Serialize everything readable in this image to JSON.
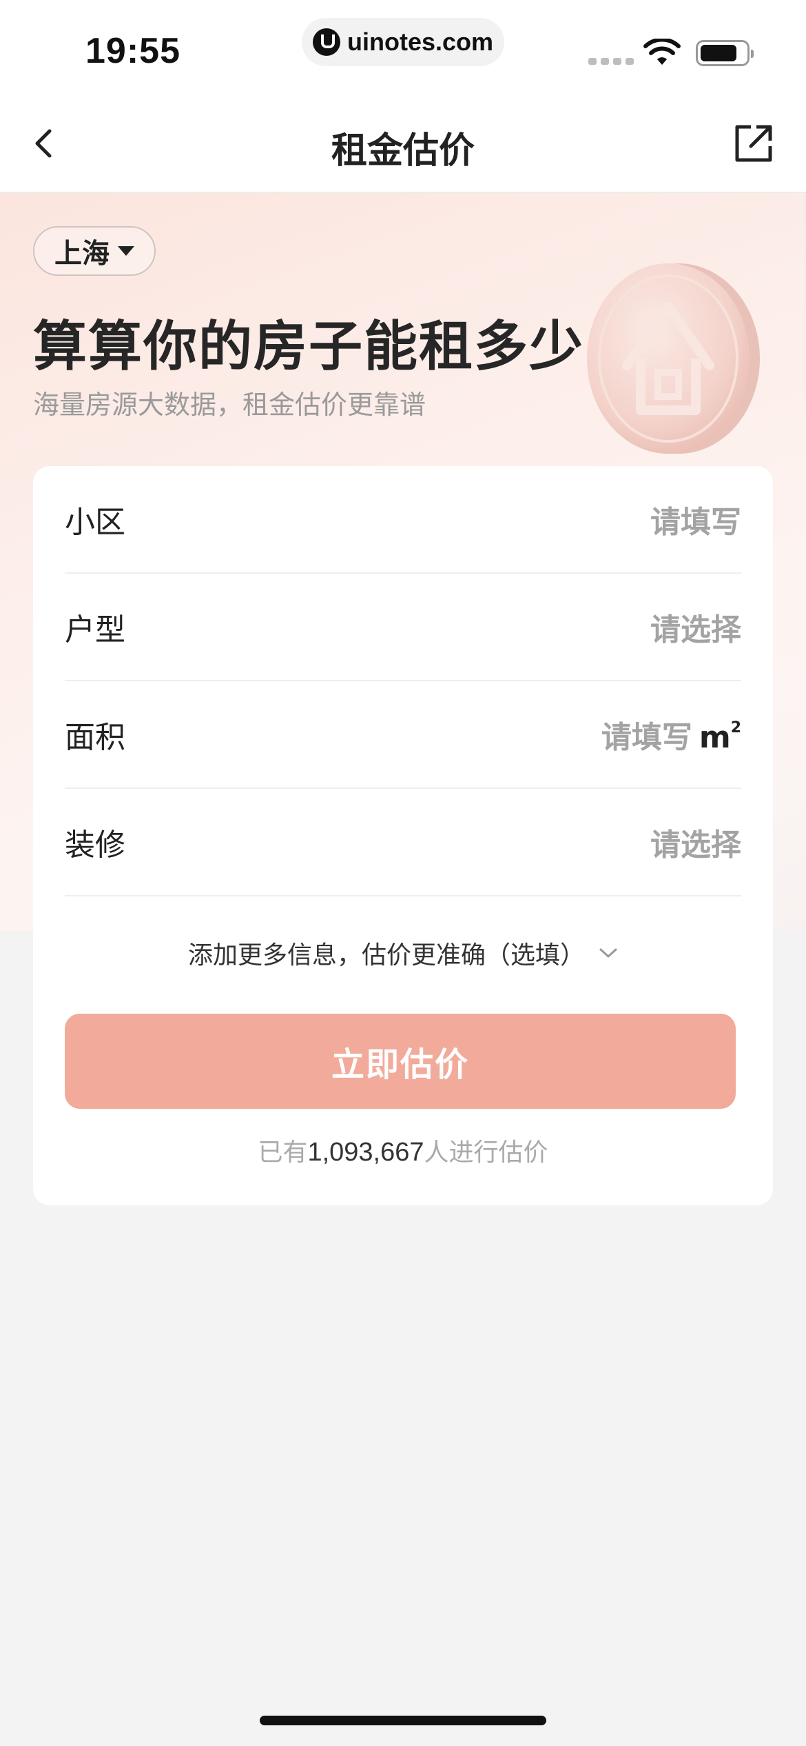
{
  "status_bar": {
    "time": "19:55",
    "url": "uinotes.com"
  },
  "nav": {
    "title": "租金估价",
    "back_icon": "chevron-left-icon",
    "share_icon": "external-link-icon"
  },
  "hero": {
    "city": "上海",
    "title": "算算你的房子能租多少",
    "subtitle": "海量房源大数据，租金估价更靠谱"
  },
  "form": {
    "rows": [
      {
        "label": "小区",
        "value": "请填写"
      },
      {
        "label": "户型",
        "value": "请选择"
      },
      {
        "label": "面积",
        "value": "请填写",
        "unit": "m",
        "unit_sup": "2"
      },
      {
        "label": "装修",
        "value": "请选择"
      }
    ],
    "more_info": "添加更多信息，估价更准确（选填）",
    "submit_label": "立即估价",
    "usage_prefix": "已有",
    "usage_count": "1,093,667",
    "usage_suffix": "人进行估价"
  },
  "colors": {
    "button": "#f2aa9b",
    "hero_bg": "#fbe5de",
    "placeholder": "#a3a3a3"
  }
}
